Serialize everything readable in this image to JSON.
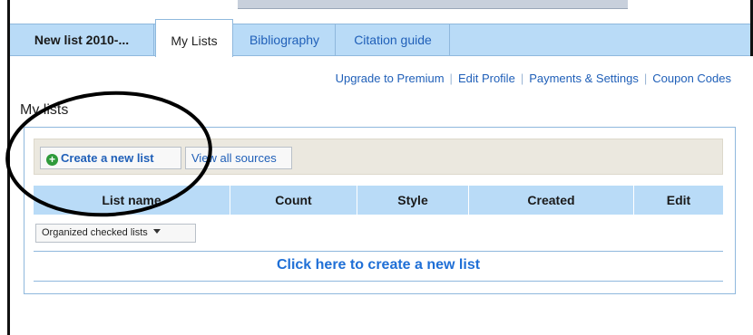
{
  "tabs": {
    "list_name": "New list 2010-...",
    "my_lists": "My Lists",
    "bibliography": "Bibliography",
    "citation_guide": "Citation guide"
  },
  "account_links": [
    "Upgrade to Premium",
    "Edit Profile",
    "Payments & Settings",
    "Coupon Codes"
  ],
  "section_title": "My lists",
  "toolbar": {
    "create_label": "Create a new list",
    "view_label": "View all sources",
    "create_icon": "plus-circle-icon"
  },
  "table": {
    "columns": [
      "List name",
      "Count",
      "Style",
      "Created",
      "Edit"
    ]
  },
  "filter": {
    "selected": "Organized checked lists",
    "icon": "caret-down-icon"
  },
  "create_link": "Click here to create a new list",
  "colors": {
    "tab_bar": "#b9dbf7",
    "link": "#1f5fb8",
    "plus_icon": "#2e9a3a",
    "toolbar_bg": "#ebe8df"
  }
}
